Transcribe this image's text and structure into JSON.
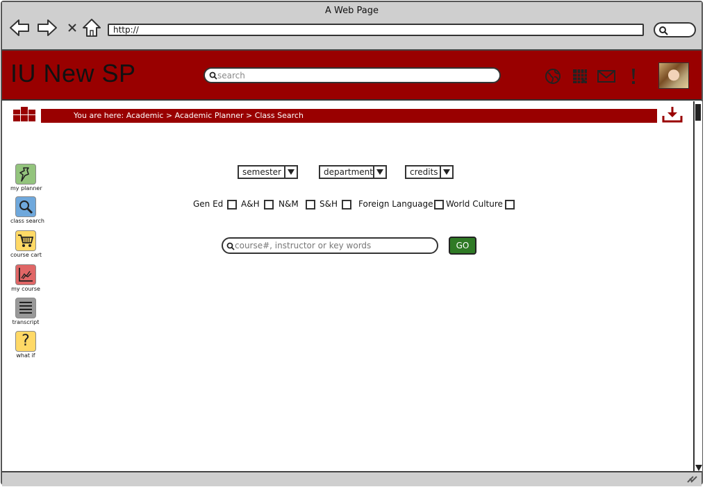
{
  "window": {
    "title": "A Web Page"
  },
  "browser": {
    "url": "http://"
  },
  "header": {
    "app_title": "IU New SP",
    "search_placeholder": "search",
    "icons": [
      "globe-icon",
      "calendar-icon",
      "mail-icon",
      "alert-icon"
    ]
  },
  "breadcrumb": {
    "text": "You are here: Academic > Academic Planner > Class Search"
  },
  "sidebar": {
    "items": [
      {
        "label": "my planner",
        "icon": "pin-icon",
        "color": "#93c47d"
      },
      {
        "label": "class search",
        "icon": "magnifier-icon",
        "color": "#6fa8dc"
      },
      {
        "label": "course cart",
        "icon": "cart-icon",
        "color": "#ffd966"
      },
      {
        "label": "my course",
        "icon": "chart-icon",
        "color": "#e06666"
      },
      {
        "label": "transcript",
        "icon": "list-icon",
        "color": "#999999"
      },
      {
        "label": "what if",
        "icon": "question-icon",
        "color": "#ffd966"
      }
    ]
  },
  "filters": {
    "dropdowns": [
      {
        "label": "semester"
      },
      {
        "label": "department"
      },
      {
        "label": "credits"
      }
    ],
    "checkboxes": [
      {
        "label": "Gen Ed",
        "checked": false
      },
      {
        "label": "A&H",
        "checked": false
      },
      {
        "label": "N&M",
        "checked": false
      },
      {
        "label": "S&H",
        "checked": false
      },
      {
        "label": "Foreign Language",
        "checked": false
      },
      {
        "label": "World Culture",
        "checked": false
      }
    ]
  },
  "search": {
    "placeholder": "course#, instructor or key words",
    "go_label": "GO"
  },
  "colors": {
    "brand": "#990000",
    "go": "#2f7a25"
  }
}
